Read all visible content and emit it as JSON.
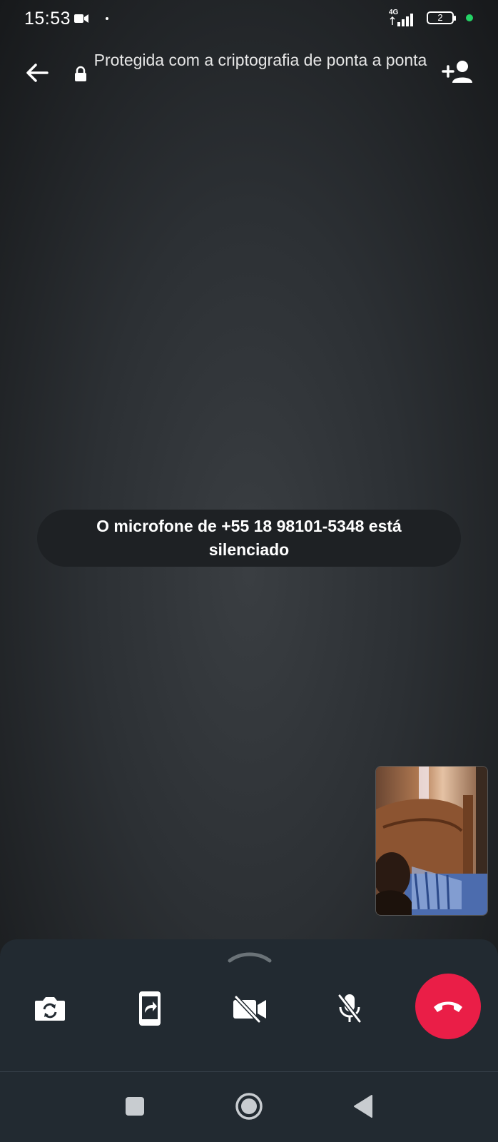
{
  "status_bar": {
    "time": "15:53",
    "network": "4G",
    "battery_label": "2",
    "icons": [
      "video-recording-icon",
      "signal-icon",
      "battery-icon",
      "green-dot-indicator"
    ]
  },
  "top_bar": {
    "encryption_text": "Protegida com a criptografia de ponta a ponta",
    "icons": [
      "back-arrow-icon",
      "lock-icon",
      "add-participant-icon"
    ]
  },
  "toast": {
    "message": "O microfone de +55 18 98101-5348 está silenciado"
  },
  "controls": {
    "icons": [
      "flip-camera-icon",
      "share-screen-icon",
      "video-off-icon",
      "mic-off-icon",
      "end-call-icon"
    ]
  },
  "nav_bar": {
    "icons": [
      "recents-icon",
      "home-icon",
      "back-icon"
    ]
  },
  "colors": {
    "end_call": "#ea1e47",
    "online_dot": "#24d366",
    "panel": "#222a31"
  }
}
